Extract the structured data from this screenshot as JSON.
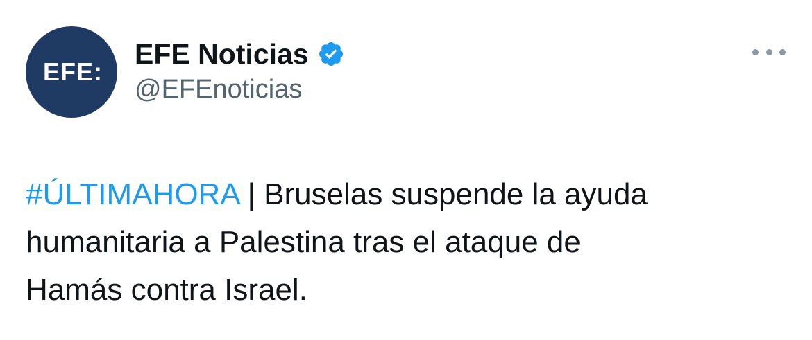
{
  "author": {
    "avatar_text": "EFE:",
    "display_name": "EFE Noticias",
    "handle": "@EFEnoticias",
    "verified": true,
    "avatar_color": "#1f3a63",
    "verified_color": "#1d9bf0"
  },
  "tweet": {
    "hashtag": "#ÚLTIMAHORA",
    "text_line1": " | Bruselas suspende la ayuda",
    "text_line2": "humanitaria a Palestina tras el ataque de",
    "text_line3": "Hamás contra Israel."
  },
  "icons": {
    "more": "more-horizontal-icon",
    "verified": "verified-badge-icon"
  },
  "colors": {
    "hashtag": "#1d9bf0",
    "handle": "#536471",
    "text": "#0f1419"
  }
}
